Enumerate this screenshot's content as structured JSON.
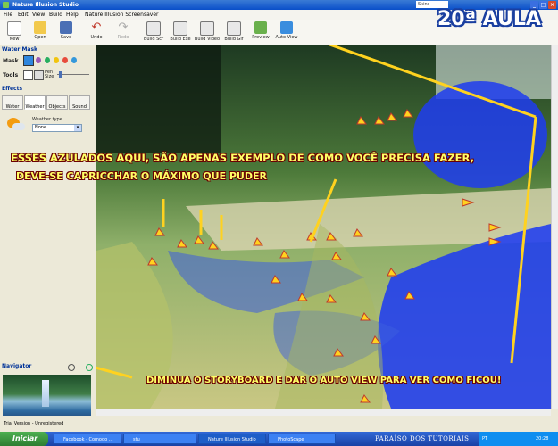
{
  "window": {
    "title": "Nature Illusion Studio",
    "skin_label": "Skins"
  },
  "menu": [
    "File",
    "Edit",
    "View",
    "Build",
    "Help",
    "Nature Illusion Screensaver"
  ],
  "toolbar": {
    "buttons": [
      {
        "label": "New"
      },
      {
        "label": "Open"
      },
      {
        "label": "Save"
      },
      {
        "label": "Undo"
      },
      {
        "label": "Redo"
      },
      {
        "label": "Build Scr"
      },
      {
        "label": "Build Exe"
      },
      {
        "label": "Build Video"
      },
      {
        "label": "Build Gif"
      },
      {
        "label": "Preview"
      },
      {
        "label": "Auto View"
      }
    ]
  },
  "sidebar": {
    "water_mask_title": "Water Mask",
    "mask_label": "Mask",
    "tools_label": "Tools",
    "pen_size_label": "Pen Size",
    "effects_title": "Effects",
    "tabs": [
      {
        "label": "Water"
      },
      {
        "label": "Weather"
      },
      {
        "label": "Objects"
      },
      {
        "label": "Sound"
      }
    ],
    "weather_type_label": "Weather type",
    "weather_type_value": "None",
    "navigator_title": "Navigator"
  },
  "overlay": {
    "lesson_title": "20ª AULA",
    "line1": "ESSES AZULADOS AQUI, SÃO APENAS EXEMPLO DE COMO VOCÊ PRECISA FAZER,",
    "line2": "DEVE-SE CAPRICCHAR O MÁXIMO QUE PUDER",
    "line3": "DIMINUA O STORYBOARD E DAR O AUTO VIEW  PARA VER COMO FICOU!"
  },
  "status": {
    "text": "Trial Version - Unregistered"
  },
  "taskbar": {
    "start": "Iniciar",
    "tasks": [
      "Facebook - Comodo ...",
      "stu",
      "Nature Illusion Studio",
      "PhotoScape"
    ],
    "brand": "PARAÍSO DOS TUTORIAIS",
    "lang": "PT",
    "clock": "20:28"
  }
}
